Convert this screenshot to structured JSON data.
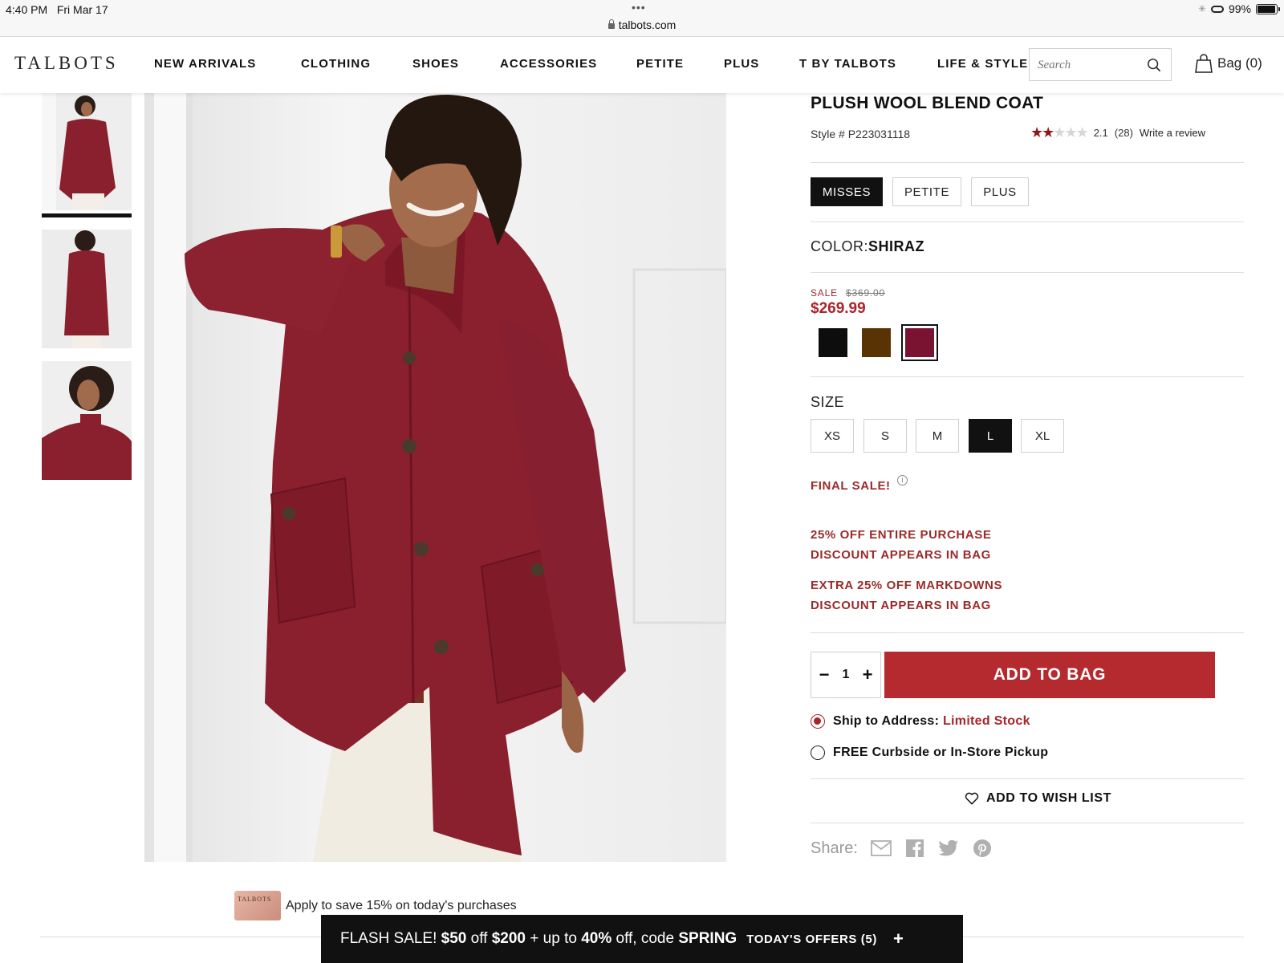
{
  "status_bar": {
    "time": "4:40 PM",
    "date": "Fri Mar 17",
    "url": "talbots.com",
    "battery": "99%"
  },
  "nav": {
    "logo": "TALBOTS",
    "links": [
      "NEW ARRIVALS",
      "CLOTHING",
      "SHOES",
      "ACCESSORIES",
      "PETITE",
      "PLUS",
      "T BY TALBOTS",
      "LIFE & STYLE"
    ],
    "search_placeholder": "Search",
    "bag_label": "Bag (0)"
  },
  "product": {
    "title": "PLUSH WOOL BLEND COAT",
    "style_number": "Style # P223031118",
    "rating": 2.1,
    "rating_text": "2.1",
    "review_count": "(28)",
    "write_review": "Write a review",
    "fits": [
      "MISSES",
      "PETITE",
      "PLUS"
    ],
    "selected_fit": "MISSES",
    "color_label": "COLOR:",
    "color_value": "SHIRAZ",
    "sale_label": "SALE",
    "original_price": "$369.00",
    "sale_price": "$269.99",
    "swatches": [
      {
        "name": "black",
        "color": "#0d0d0d"
      },
      {
        "name": "brown",
        "color": "#5a3305"
      },
      {
        "name": "shiraz",
        "color": "#7a1232",
        "selected": true
      }
    ],
    "size_label": "SIZE",
    "sizes": [
      "XS",
      "S",
      "M",
      "L",
      "XL"
    ],
    "selected_size": "L",
    "final_sale": "FINAL SALE!",
    "promos": [
      {
        "line1": "25% OFF ENTIRE PURCHASE",
        "line2": "DISCOUNT APPEARS IN BAG"
      },
      {
        "line1": "EXTRA 25% OFF MARKDOWNS",
        "line2": "DISCOUNT APPEARS IN BAG"
      }
    ],
    "quantity": "1",
    "add_to_bag": "ADD TO BAG",
    "ship_to_address": "Ship to Address:",
    "ship_stock": "Limited Stock",
    "pickup": "FREE Curbside or In-Store Pickup",
    "wish_list": "ADD TO WISH LIST",
    "share_label": "Share:"
  },
  "bottom": {
    "card_text": "Apply to save 15% on today's purchases",
    "card_logo": "TALBOTS",
    "flash": {
      "prefix": "FLASH SALE!",
      "amount_off": "$50",
      "off_word": "off",
      "threshold": "$200",
      "plus_upto": "+ up to",
      "pct": "40%",
      "off_code": "off, code",
      "code": "SPRING",
      "offers": "TODAY'S OFFERS (5)",
      "expand": "+"
    }
  },
  "colors": {
    "accent_red": "#b52a2e",
    "sale_red": "#9b2a2a",
    "coat": "#8a1f2d"
  }
}
